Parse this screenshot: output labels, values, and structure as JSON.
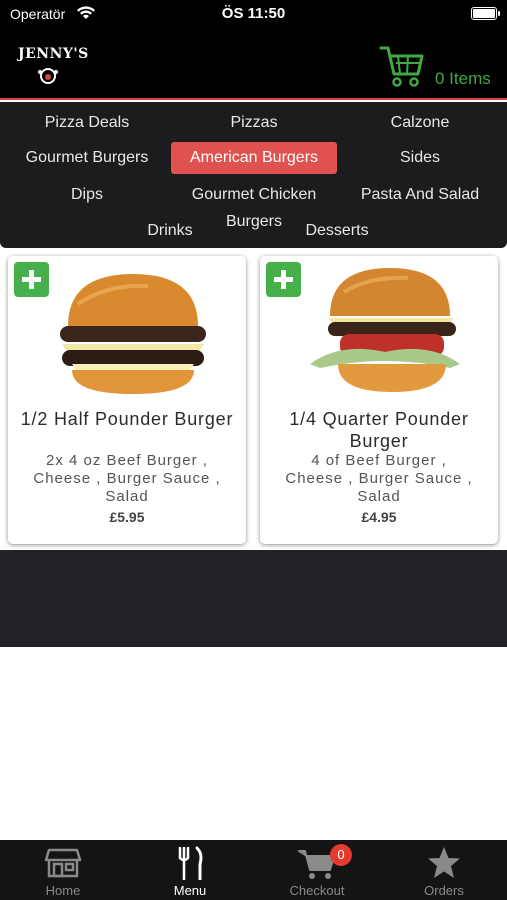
{
  "status_bar": {
    "carrier": "Operatör",
    "time": "ÖS 11:50"
  },
  "header": {
    "logo_text": "JENNY'S",
    "cart_label": "0 Items",
    "accent_color": "#3fa943",
    "divider_color": "#d64444"
  },
  "categories": {
    "items": [
      "Pizza Deals",
      "Pizzas",
      "Calzone",
      "Gourmet Burgers",
      "American Burgers",
      "Sides",
      "Dips",
      "Gourmet Chicken",
      "Pasta And Salad",
      "Drinks",
      "Burgers",
      "Desserts"
    ],
    "selected": "American Burgers",
    "selected_color": "#e0524f"
  },
  "products": [
    {
      "name": "1/2 Half Pounder Burger",
      "description": "2x 4 oz Beef Burger , Cheese , Burger Sauce , Salad",
      "price": "£5.95",
      "icon": "plus-icon"
    },
    {
      "name": "1/4 Quarter Pounder Burger",
      "description": "4 of Beef Burger , Cheese , Burger Sauce , Salad",
      "price": "£4.95",
      "icon": "plus-icon"
    }
  ],
  "tabbar": {
    "tabs": [
      {
        "label": "Home",
        "icon": "store-icon"
      },
      {
        "label": "Menu",
        "icon": "fork-knife-icon"
      },
      {
        "label": "Checkout",
        "icon": "cart-icon"
      },
      {
        "label": "Orders",
        "icon": "star-icon"
      }
    ],
    "active": "Menu",
    "checkout_badge": "0"
  }
}
